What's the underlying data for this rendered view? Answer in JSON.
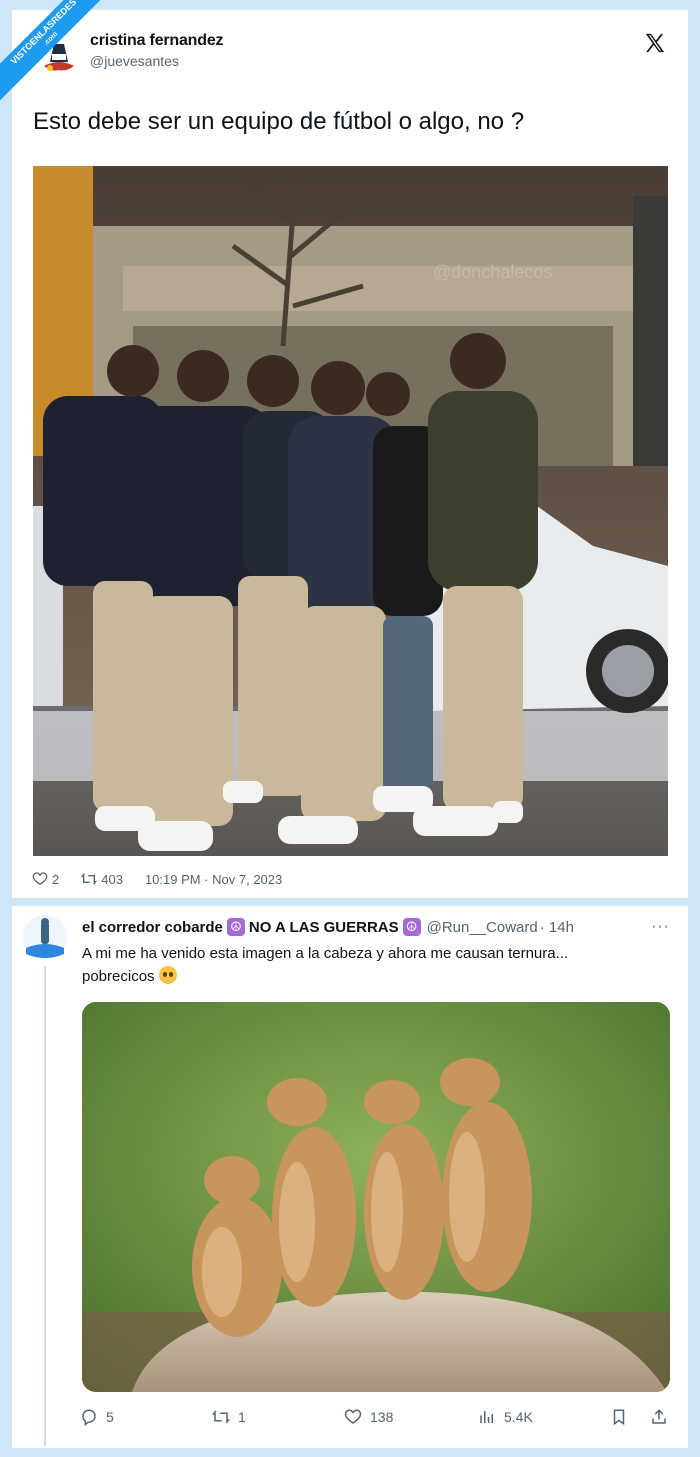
{
  "watermark": {
    "line1": "VISTOENLASREDES",
    "line2": ".com"
  },
  "tweet1": {
    "author_name": "cristina fernandez",
    "author_handle": "@juevesantes",
    "text": "Esto debe ser un equipo de fútbol o algo, no ?",
    "photo_watermark": "@donchalecos",
    "likes": "2",
    "retweets": "403",
    "timestamp": "10:19 PM · Nov 7, 2023"
  },
  "tweet2": {
    "author_name": "el corredor cobarde",
    "name_suffix": "NO A LAS GUERRAS",
    "author_handle": "@Run__Coward",
    "time_ago": "· 14h",
    "more_label": "···",
    "text_line1": "A mi me ha venido esta imagen a la cabeza y ahora me causan ternura...",
    "text_line2": "pobrecicos",
    "replies": "5",
    "retweets": "1",
    "likes": "138",
    "views": "5.4K"
  },
  "colors": {
    "brand": "#1d9bf0",
    "muted": "#536471",
    "background": "#cfe6f7"
  },
  "icons": [
    "x-logo-icon",
    "heart-icon",
    "retweet-icon",
    "reply-icon",
    "views-icon",
    "bookmark-icon",
    "share-icon",
    "peace-icon"
  ]
}
